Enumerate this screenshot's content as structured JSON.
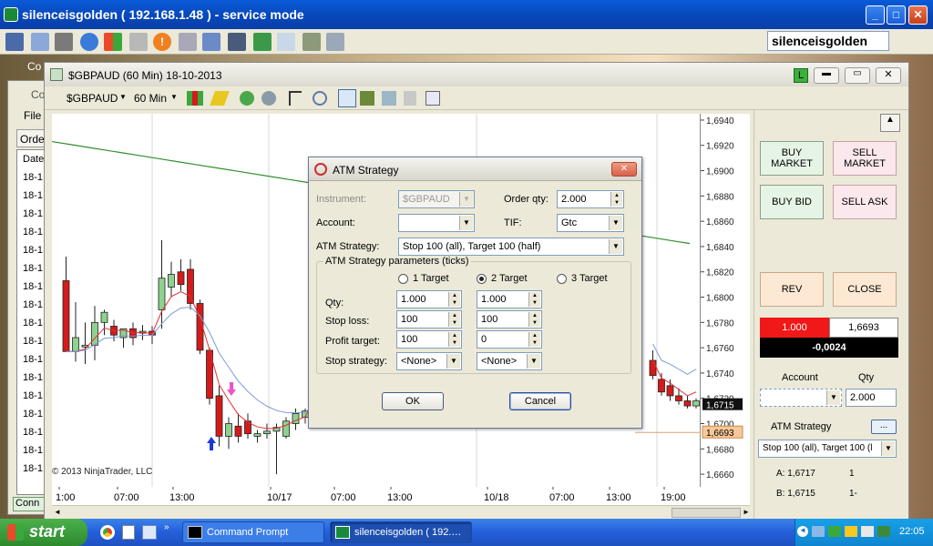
{
  "outer_window": {
    "title": "silenceisgolden ( 192.168.1.48 ) - service mode",
    "account_box": "silenceisgolden"
  },
  "bg_tabs": {
    "tab1": "Co",
    "tab2": "Co",
    "file_menu": "File",
    "orders_tab": "Orde",
    "date_col": "Date",
    "row_label": "18-1",
    "conn": "Conn"
  },
  "chart_window": {
    "title": "$GBPAUD (60 Min)  18-10-2013",
    "instrument": "$GBPAUD",
    "interval": "60 Min",
    "copyright": "© 2013 NinjaTrader, LLC",
    "title_btn_L": "L"
  },
  "chart_data": {
    "type": "candlestick",
    "ylim": [
      1.665,
      1.6945
    ],
    "y_ticks": [
      "1,6940",
      "1,6920",
      "1,6900",
      "1,6880",
      "1,6860",
      "1,6840",
      "1,6820",
      "1,6800",
      "1,6780",
      "1,6760",
      "1,6740",
      "1,6720",
      "1,6700",
      "1,6680",
      "1,6660"
    ],
    "x_ticks": [
      "1:00",
      "07:00",
      "13:00",
      "10/17",
      "07:00",
      "13:00",
      "10/18",
      "07:00",
      "13:00",
      "19:00"
    ],
    "last_price_label": "1,6715",
    "marker_price_label": "1,6693",
    "candles": [
      {
        "o": 1.6813,
        "h": 1.6832,
        "l": 1.676,
        "c": 1.6757,
        "dir": "down"
      },
      {
        "o": 1.6768,
        "h": 1.6796,
        "l": 1.6749,
        "c": 1.6757,
        "dir": "up"
      },
      {
        "o": 1.6762,
        "h": 1.678,
        "l": 1.6747,
        "c": 1.6762,
        "dir": "up"
      },
      {
        "o": 1.6762,
        "h": 1.6793,
        "l": 1.675,
        "c": 1.678,
        "dir": "up"
      },
      {
        "o": 1.678,
        "h": 1.679,
        "l": 1.677,
        "c": 1.6788,
        "dir": "up"
      },
      {
        "o": 1.6777,
        "h": 1.6782,
        "l": 1.6765,
        "c": 1.677,
        "dir": "down"
      },
      {
        "o": 1.6768,
        "h": 1.6775,
        "l": 1.676,
        "c": 1.6775,
        "dir": "up"
      },
      {
        "o": 1.6775,
        "h": 1.678,
        "l": 1.6762,
        "c": 1.6768,
        "dir": "down"
      },
      {
        "o": 1.6772,
        "h": 1.6778,
        "l": 1.6766,
        "c": 1.6773,
        "dir": "up"
      },
      {
        "o": 1.6773,
        "h": 1.6777,
        "l": 1.6763,
        "c": 1.677,
        "dir": "down"
      },
      {
        "o": 1.679,
        "h": 1.6845,
        "l": 1.6775,
        "c": 1.6815,
        "dir": "up"
      },
      {
        "o": 1.6808,
        "h": 1.6828,
        "l": 1.68,
        "c": 1.6818,
        "dir": "up"
      },
      {
        "o": 1.682,
        "h": 1.683,
        "l": 1.6805,
        "c": 1.681,
        "dir": "down"
      },
      {
        "o": 1.6822,
        "h": 1.683,
        "l": 1.679,
        "c": 1.6795,
        "dir": "down"
      },
      {
        "o": 1.6795,
        "h": 1.6798,
        "l": 1.6755,
        "c": 1.6758,
        "dir": "down"
      },
      {
        "o": 1.6758,
        "h": 1.676,
        "l": 1.6715,
        "c": 1.672,
        "dir": "down"
      },
      {
        "o": 1.6722,
        "h": 1.673,
        "l": 1.6682,
        "c": 1.669,
        "dir": "down"
      },
      {
        "o": 1.669,
        "h": 1.6705,
        "l": 1.668,
        "c": 1.67,
        "dir": "up"
      },
      {
        "o": 1.6698,
        "h": 1.6708,
        "l": 1.6685,
        "c": 1.669,
        "dir": "down"
      },
      {
        "o": 1.6702,
        "h": 1.6708,
        "l": 1.6688,
        "c": 1.6692,
        "dir": "down"
      },
      {
        "o": 1.669,
        "h": 1.6695,
        "l": 1.6685,
        "c": 1.6692,
        "dir": "up"
      },
      {
        "o": 1.6692,
        "h": 1.67,
        "l": 1.6688,
        "c": 1.6694,
        "dir": "up"
      },
      {
        "o": 1.6694,
        "h": 1.67,
        "l": 1.666,
        "c": 1.6697,
        "dir": "up"
      },
      {
        "o": 1.669,
        "h": 1.6705,
        "l": 1.6688,
        "c": 1.6702,
        "dir": "up"
      },
      {
        "o": 1.67,
        "h": 1.6712,
        "l": 1.6695,
        "c": 1.6708,
        "dir": "up"
      },
      {
        "o": 1.6705,
        "h": 1.6712,
        "l": 1.67,
        "c": 1.671,
        "dir": "up"
      },
      {
        "o": 1.6712,
        "h": 1.6745,
        "l": 1.67,
        "c": 1.674,
        "dir": "up"
      }
    ],
    "right_candles": [
      {
        "o": 1.675,
        "h": 1.6758,
        "l": 1.6735,
        "c": 1.6738,
        "dir": "down"
      },
      {
        "o": 1.6735,
        "h": 1.674,
        "l": 1.6722,
        "c": 1.6725,
        "dir": "down"
      },
      {
        "o": 1.673,
        "h": 1.6735,
        "l": 1.6718,
        "c": 1.6722,
        "dir": "down"
      },
      {
        "o": 1.6722,
        "h": 1.6728,
        "l": 1.6715,
        "c": 1.6718,
        "dir": "down"
      },
      {
        "o": 1.6718,
        "h": 1.6722,
        "l": 1.6712,
        "c": 1.6714,
        "dir": "down"
      },
      {
        "o": 1.6714,
        "h": 1.672,
        "l": 1.6712,
        "c": 1.6718,
        "dir": "up"
      }
    ]
  },
  "dialog": {
    "title": "ATM Strategy",
    "instrument_label": "Instrument:",
    "instrument_value": "$GBPAUD",
    "order_qty_label": "Order qty:",
    "order_qty_value": "2.000",
    "account_label": "Account:",
    "tif_label": "TIF:",
    "tif_value": "Gtc",
    "atm_label": "ATM Strategy:",
    "atm_value": "Stop 100 (all), Target 100 (half)",
    "params_label": "ATM Strategy parameters (ticks)",
    "target1": "1 Target",
    "target2": "2 Target",
    "target3": "3 Target",
    "qty_label": "Qty:",
    "stop_loss_label": "Stop loss:",
    "profit_target_label": "Profit target:",
    "stop_strategy_label": "Stop strategy:",
    "col1": {
      "qty": "1.000",
      "stop": "100",
      "profit": "100",
      "strategy": "<None>"
    },
    "col2": {
      "qty": "1.000",
      "stop": "100",
      "profit": "0",
      "strategy": "<None>"
    },
    "ok": "OK",
    "cancel": "Cancel"
  },
  "right_panel": {
    "buy_market": "BUY MARKET",
    "sell_market": "SELL MARKET",
    "buy_bid": "BUY BID",
    "sell_ask": "SELL ASK",
    "rev": "REV",
    "close": "CLOSE",
    "position_qty": "1.000",
    "position_price": "1,6693",
    "pnl": "-0,0024",
    "account_label": "Account",
    "qty_label": "Qty",
    "qty_value": "2.000",
    "atm_label": "ATM Strategy",
    "atm_btn": "...",
    "atm_value": "Stop 100 (all), Target 100 (l",
    "ask": "A: 1,6717",
    "ask_size": "1",
    "bid": "B: 1,6715",
    "bid_size": "1-"
  },
  "taskbar": {
    "start": "start",
    "task1": "Command Prompt",
    "task2": "silenceisgolden ( 192.…",
    "clock": "22:05"
  },
  "colors": {
    "up_candle": "#8fd18f",
    "down_candle": "#d41a1a",
    "sma_green": "#2f8f2f",
    "ema_red": "#e03030",
    "ema_blue": "#7a9ad8"
  }
}
